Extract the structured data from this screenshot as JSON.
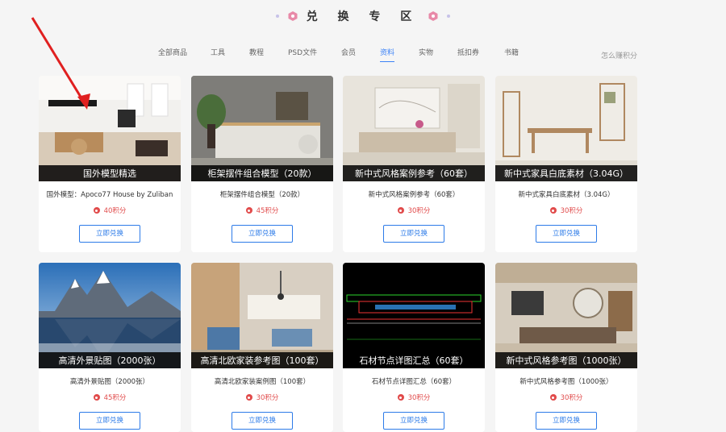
{
  "header": {
    "title": "兑 换 专 区"
  },
  "nav": {
    "items": [
      "全部商品",
      "工具",
      "教程",
      "PSD文件",
      "会员",
      "资料",
      "实物",
      "抵扣券",
      "书籍"
    ],
    "active_index": 5,
    "help": "怎么赚积分"
  },
  "colors": {
    "accent": "#2d7be8",
    "points": "#e14b4b",
    "caption_bg": "#000000"
  },
  "cards": [
    {
      "caption": "国外模型精选",
      "desc": "国外模型：Apoco77 House by Zuliban",
      "points": "40积分",
      "button": "立即兑换"
    },
    {
      "caption": "柜架摆件组合模型（20款）",
      "desc": "柜架摆件组合模型（20款）",
      "points": "45积分",
      "button": "立即兑换"
    },
    {
      "caption": "新中式风格案例参考（60套）",
      "desc": "新中式风格案例参考（60套）",
      "points": "30积分",
      "button": "立即兑换"
    },
    {
      "caption": "新中式家具白底素材（3.04G）",
      "desc": "新中式家具白底素材（3.04G）",
      "points": "30积分",
      "button": "立即兑换"
    },
    {
      "caption": "高清外景贴图（2000张）",
      "desc": "高清外景贴图（2000张）",
      "points": "45积分",
      "button": "立即兑换"
    },
    {
      "caption": "高清北欧家装参考图（100套）",
      "desc": "高清北欧家装案例图（100套）",
      "points": "30积分",
      "button": "立即兑换"
    },
    {
      "caption": "石材节点详图汇总（60套）",
      "desc": "石材节点详图汇总（60套）",
      "points": "30积分",
      "button": "立即兑换"
    },
    {
      "caption": "新中式风格参考图（1000张）",
      "desc": "新中式风格参考图（1000张）",
      "points": "30积分",
      "button": "立即兑换"
    }
  ]
}
